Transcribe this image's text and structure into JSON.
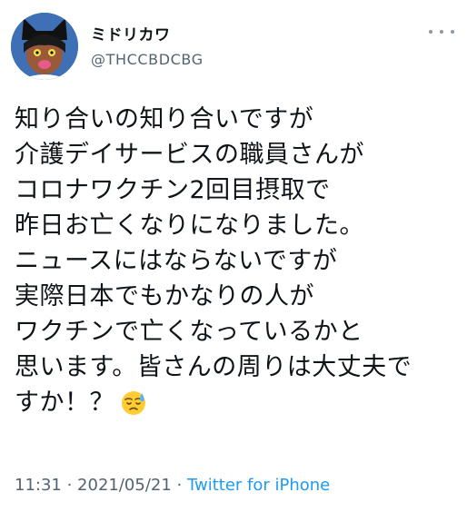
{
  "user": {
    "name": "ミドリカワ",
    "handle": "@THCCBDCBG"
  },
  "tweet": {
    "lines": [
      "知り合いの知り合いですが",
      "介護デイサービスの職員さんが",
      "コロナワクチン2回目摂取で",
      "昨日お亡くなりになりました。",
      "ニュースにはならないですが",
      "実際日本でもかなりの人が",
      "ワクチンで亡くなっているかと",
      "思います。皆さんの周りは大丈夫で",
      "すか！？"
    ],
    "emoji": "downcast-face-with-sweat"
  },
  "meta": {
    "time": "11:31",
    "sep1": " · ",
    "date": "2021/05/21",
    "sep2": " · ",
    "source": "Twitter for iPhone"
  },
  "colors": {
    "text": "#0f1419",
    "secondary": "#536471",
    "link": "#1d9bf0"
  }
}
